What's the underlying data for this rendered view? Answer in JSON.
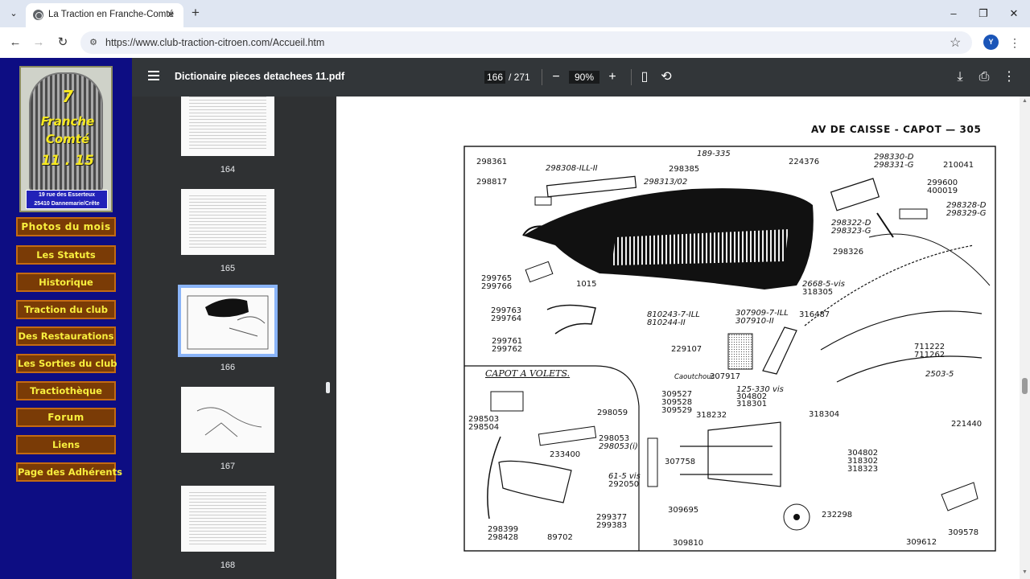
{
  "browser": {
    "tab_title": "La Traction en Franche-Comté",
    "url": "https://www.club-traction-citroen.com/Accueil.htm",
    "profile_initial": "Y"
  },
  "site": {
    "logo_lines": [
      "7",
      "Franche",
      "Comté",
      "11 . 15"
    ],
    "logo_address": [
      "19 rue des Esserteux",
      "25410 Dannemarie/Crête"
    ],
    "nav": [
      "Photos du mois",
      "Les Statuts",
      "Historique",
      "Traction du club",
      "Des Restaurations",
      "Les Sorties du club",
      "Tractiothèque",
      "Forum",
      "Liens",
      "Page des Adhérents"
    ]
  },
  "pdf": {
    "file_name": "Dictionaire pieces detachees 11.pdf",
    "current_page": "166",
    "total_pages": "/ 271",
    "zoom": "90%",
    "thumbnails": [
      "164",
      "165",
      "166",
      "167",
      "168"
    ],
    "page_header": "AV DE CAISSE - CAPOT — 305",
    "section_label": "CAPOT A VOLETS.",
    "parts": [
      "298361",
      "298817",
      "298308-ILL-II",
      "298313/02",
      "189-335",
      "298385",
      "224376",
      "298330-D",
      "298331-G",
      "210041",
      "299600",
      "400019",
      "298328-D",
      "298329-G",
      "298322-D",
      "298323-G",
      "298326",
      "299765",
      "299766",
      "1015",
      "299763",
      "299764",
      "299761",
      "299762",
      "810243-7-ILL",
      "810244-II",
      "2668-5-vis",
      "318305",
      "316487",
      "307909-7-ILL",
      "307910-II",
      "229107",
      "711222",
      "711262",
      "Caoutchouc",
      "307917",
      "2503-5",
      "125-330 vis",
      "304802",
      "318301",
      "309527",
      "309528",
      "309529",
      "318232",
      "318304",
      "221440",
      "298503",
      "298504",
      "298059",
      "298053",
      "298053(i)",
      "233400",
      "61-5 vis",
      "292050",
      "307758",
      "304802",
      "318302",
      "318323",
      "309695",
      "232298",
      "299377",
      "299383",
      "298399",
      "298428",
      "89702",
      "309810",
      "309612",
      "309578"
    ]
  }
}
